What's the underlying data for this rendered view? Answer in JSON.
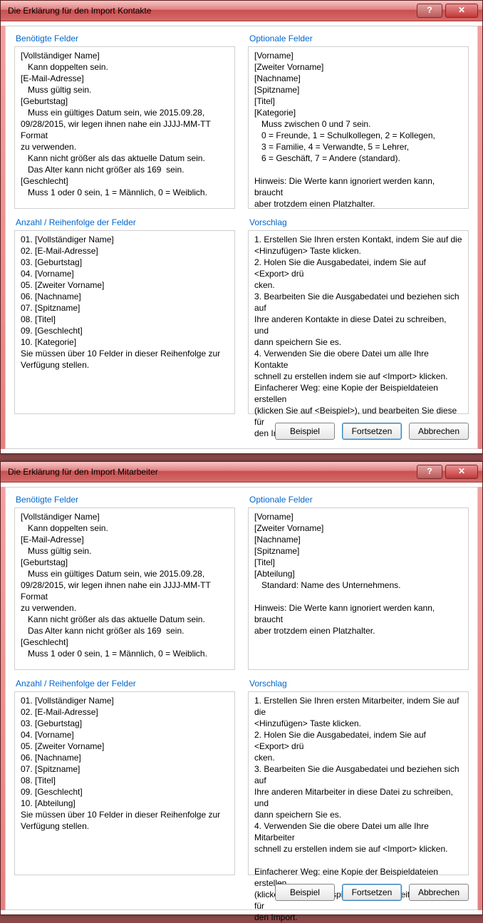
{
  "dialogs": [
    {
      "title": "Die Erklärung für den Import Kontakte",
      "section_required_header": "Benötigte Felder",
      "section_required_body": "[Vollständiger Name]\n   Kann doppelten sein.\n[E-Mail-Adresse]\n   Muss gültig sein.\n[Geburtstag]\n   Muss ein gültiges Datum sein, wie 2015.09.28,\n09/28/2015, wir legen ihnen nahe ein JJJJ-MM-TT Format\nzu verwenden.\n   Kann nicht größer als das aktuelle Datum sein.\n   Das Alter kann nicht größer als 169  sein.\n[Geschlecht]\n   Muss 1 oder 0 sein, 1 = Männlich, 0 = Weiblich.",
      "section_optional_header": "Optionale Felder",
      "section_optional_body": "[Vorname]\n[Zweiter Vorname]\n[Nachname]\n[Spitzname]\n[Titel]\n[Kategorie]\n   Muss zwischen 0 und 7 sein.\n   0 = Freunde, 1 = Schulkollegen, 2 = Kollegen,\n   3 = Familie, 4 = Verwandte, 5 = Lehrer,\n   6 = Geschäft, 7 = Andere (standard).\n\nHinweis: Die Werte kann ignoriert werden kann, braucht\naber trotzdem einen Platzhalter.",
      "section_order_header": "Anzahl / Reihenfolge der Felder",
      "section_order_body": "01. [Vollständiger Name]\n02. [E-Mail-Adresse]\n03. [Geburtstag]\n04. [Vorname]\n05. [Zweiter Vorname]\n06. [Nachname]\n07. [Spitzname]\n08. [Titel]\n09. [Geschlecht]\n10. [Kategorie]\nSie müssen über 10 Felder in dieser Reihenfolge zur\nVerfügung stellen.",
      "section_suggestion_header": "Vorschlag",
      "section_suggestion_body": "1. Erstellen Sie Ihren ersten Kontakt, indem Sie auf die\n<Hinzufügen> Taste klicken.\n2. Holen Sie die Ausgabedatei, indem Sie auf <Export> drü\ncken.\n3. Bearbeiten Sie die Ausgabedatei und beziehen sich auf\nIhre anderen Kontakte in diese Datei zu schreiben, und\ndann speichern Sie es.\n4. Verwenden Sie die obere Datei um alle Ihre Kontakte\nschnell zu erstellen indem sie auf <Import> klicken.\nEinfacherer Weg: eine Kopie der Beispieldateien erstellen\n(klicken Sie auf <Beispiel>), und bearbeiten Sie diese für\nden Import.",
      "buttons": {
        "example": "Beispiel",
        "continue": "Fortsetzen",
        "cancel": "Abbrechen"
      }
    },
    {
      "title": "Die Erklärung für den Import Mitarbeiter",
      "section_required_header": "Benötigte Felder",
      "section_required_body": "[Vollständiger Name]\n   Kann doppelten sein.\n[E-Mail-Adresse]\n   Muss gültig sein.\n[Geburtstag]\n   Muss ein gültiges Datum sein, wie 2015.09.28,\n09/28/2015, wir legen ihnen nahe ein JJJJ-MM-TT Format\nzu verwenden.\n   Kann nicht größer als das aktuelle Datum sein.\n   Das Alter kann nicht größer als 169  sein.\n[Geschlecht]\n   Muss 1 oder 0 sein, 1 = Männlich, 0 = Weiblich.",
      "section_optional_header": "Optionale Felder",
      "section_optional_body": "[Vorname]\n[Zweiter Vorname]\n[Nachname]\n[Spitzname]\n[Titel]\n[Abteilung]\n   Standard: Name des Unternehmens.\n\nHinweis: Die Werte kann ignoriert werden kann, braucht\naber trotzdem einen Platzhalter.",
      "section_order_header": "Anzahl / Reihenfolge der Felder",
      "section_order_body": "01. [Vollständiger Name]\n02. [E-Mail-Adresse]\n03. [Geburtstag]\n04. [Vorname]\n05. [Zweiter Vorname]\n06. [Nachname]\n07. [Spitzname]\n08. [Titel]\n09. [Geschlecht]\n10. [Abteilung]\nSie müssen über 10 Felder in dieser Reihenfolge zur\nVerfügung stellen.",
      "section_suggestion_header": "Vorschlag",
      "section_suggestion_body": "1. Erstellen Sie Ihren ersten Mitarbeiter, indem Sie auf die\n<Hinzufügen> Taste klicken.\n2. Holen Sie die Ausgabedatei, indem Sie auf <Export> drü\ncken.\n3. Bearbeiten Sie die Ausgabedatei und beziehen sich auf\nIhre anderen Mitarbeiter in diese Datei zu schreiben, und\ndann speichern Sie es.\n4. Verwenden Sie die obere Datei um alle Ihre Mitarbeiter\nschnell zu erstellen indem sie auf <Import> klicken.\n\nEinfacherer Weg: eine Kopie der Beispieldateien erstellen\n(klicken Sie auf <Beispiel>), und bearbeiten Sie diese für\nden Import.",
      "buttons": {
        "example": "Beispiel",
        "continue": "Fortsetzen",
        "cancel": "Abbrechen"
      }
    }
  ]
}
